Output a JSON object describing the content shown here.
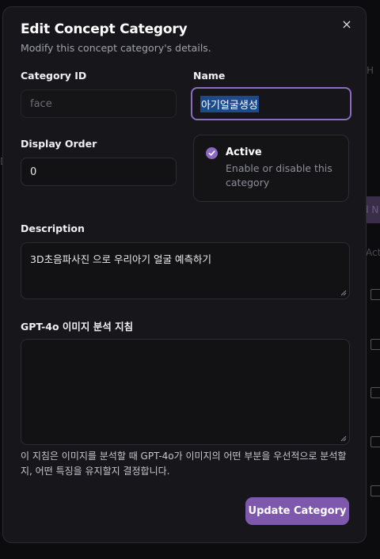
{
  "modal": {
    "title": "Edit Concept Category",
    "subtitle": "Modify this concept category's details.",
    "close_glyph": "×"
  },
  "fields": {
    "category_id": {
      "label": "Category ID",
      "value": "face",
      "disabled": true
    },
    "name": {
      "label": "Name",
      "value": "아기얼굴생성",
      "text_selected": true
    },
    "display_order": {
      "label": "Display Order",
      "value": "0"
    },
    "active": {
      "label": "Active",
      "description": "Enable or disable this category",
      "checked": true
    },
    "description": {
      "label": "Description",
      "value": "3D초음파사진 으로 우리아기 얼굴 예측하기"
    },
    "gpt_guidelines": {
      "label": "GPT-4o 이미지 분석 지침",
      "value": "",
      "help": "이 지침은 이미지를 분석할 때 GPT-4o가 이미지의 어떤 부분을 우선적으로 분석할지, 어떤 특징을 유지할지 결정합니다."
    }
  },
  "submit_label": "Update Category",
  "background_fragments": {
    "top_right": "H",
    "mid_left": "D",
    "pill": "d N",
    "actions": "Acti"
  },
  "colors": {
    "accent": "#8b68c4",
    "button": "#7e58ac",
    "focus_ring": "#8c6cc0",
    "selection": "#1f4a8a"
  }
}
